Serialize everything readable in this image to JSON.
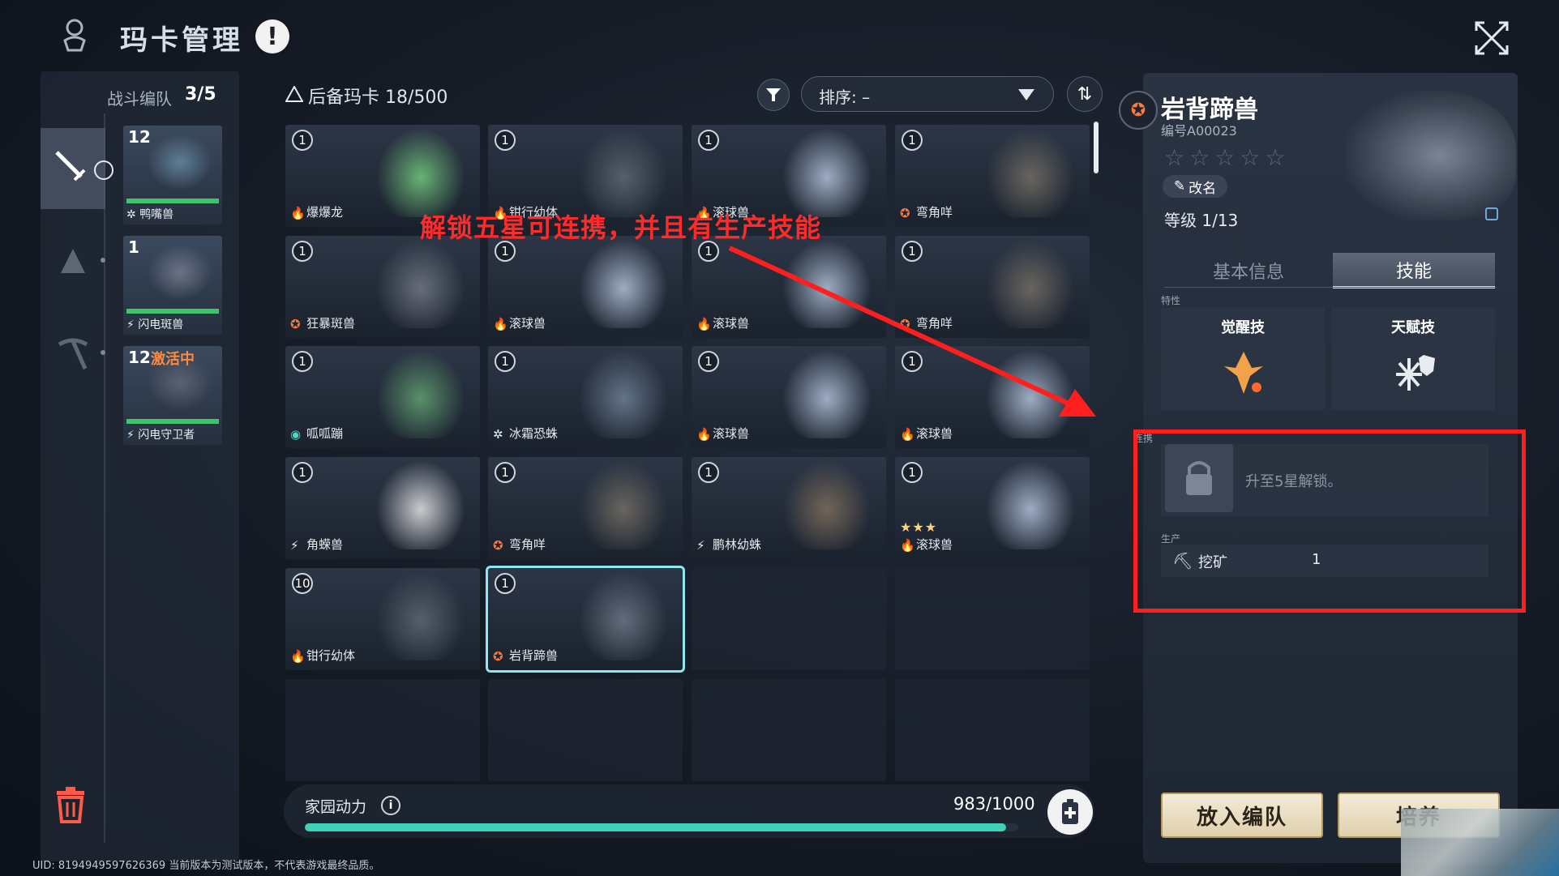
{
  "header": {
    "title": "玛卡管理",
    "alert_glyph": "!",
    "logo_icon": "emblem-icon",
    "close_icon": "collapse-icon"
  },
  "team": {
    "label": "战斗编队",
    "count": "3/5",
    "cards": [
      {
        "level": "12",
        "name": "鸭嘴兽",
        "element_glyph": "✲",
        "element_color": "#ffffff",
        "hp": 1.0,
        "color": "#5f7f95"
      },
      {
        "level": "1",
        "name": "闪电斑兽",
        "element_glyph": "⚡",
        "element_color": "#ffffff",
        "hp": 1.0,
        "color": "#6a7486"
      },
      {
        "level": "12",
        "name": "闪电守卫者",
        "element_glyph": "⚡",
        "element_color": "#ffffff",
        "hp": 1.0,
        "color": "#5a6272",
        "tag": "激活中"
      }
    ]
  },
  "reserve": {
    "label": "后备玛卡 18/500",
    "sort_label": "排序: –",
    "order_glyph": "⇅",
    "cards": [
      {
        "num": "1",
        "name": "爆爆龙",
        "element": "fire",
        "glyph": "🔥",
        "color": "#6fbf7a"
      },
      {
        "num": "1",
        "name": "钳行幼体",
        "element": "fire",
        "glyph": "🔥",
        "color": "#5a6470"
      },
      {
        "num": "1",
        "name": "滚球兽",
        "element": "fire",
        "glyph": "🔥",
        "color": "#a9b8d0"
      },
      {
        "num": "1",
        "name": "弯角咩",
        "element": "earth",
        "glyph": "✪",
        "color": "#6f6a62"
      },
      {
        "num": "1",
        "name": "狂暴斑兽",
        "element": "earth",
        "glyph": "✪",
        "color": "#6d7480"
      },
      {
        "num": "1",
        "name": "滚球兽",
        "element": "fire",
        "glyph": "🔥",
        "color": "#a9b8d0"
      },
      {
        "num": "1",
        "name": "滚球兽",
        "element": "fire",
        "glyph": "🔥",
        "color": "#a9b8d0"
      },
      {
        "num": "1",
        "name": "弯角咩",
        "element": "earth",
        "glyph": "✪",
        "color": "#6f6a62"
      },
      {
        "num": "1",
        "name": "呱呱蹦",
        "element": "water",
        "glyph": "◉",
        "color": "#5e9a6e"
      },
      {
        "num": "1",
        "name": "冰霜恐蛛",
        "element": "ice",
        "glyph": "✲",
        "color": "#6a7a90"
      },
      {
        "num": "1",
        "name": "滚球兽",
        "element": "fire",
        "glyph": "🔥",
        "color": "#a9b8d0"
      },
      {
        "num": "1",
        "name": "滚球兽",
        "element": "fire",
        "glyph": "🔥",
        "color": "#a9b8d0"
      },
      {
        "num": "1",
        "name": "角蝾兽",
        "element": "electric",
        "glyph": "⚡",
        "color": "#d9d9dc"
      },
      {
        "num": "1",
        "name": "弯角咩",
        "element": "earth",
        "glyph": "✪",
        "color": "#6f6a62"
      },
      {
        "num": "1",
        "name": "鹏林幼蛛",
        "element": "electric",
        "glyph": "⚡",
        "color": "#7a6a5a"
      },
      {
        "num": "1",
        "name": "滚球兽",
        "element": "fire",
        "glyph": "🔥",
        "color": "#a9b8d0",
        "stars": "★★★"
      },
      {
        "num": "10",
        "name": "钳行幼体",
        "element": "fire",
        "glyph": "🔥",
        "color": "#5a6470"
      },
      {
        "num": "1",
        "name": "岩背蹄兽",
        "element": "earth",
        "glyph": "✪",
        "color": "#6a7282",
        "selected": true
      }
    ],
    "empty_slots": 6
  },
  "annotation": "解锁五星可连携，并且有生产技能",
  "energy": {
    "label": "家园动力",
    "info_glyph": "i",
    "value": "983/1000",
    "fraction": 0.983
  },
  "footer": "UID: 8194949597626369 当前版本为测试版本，不代表游戏最终品质。",
  "detail": {
    "name": "岩背蹄兽",
    "id": "编号A00023",
    "stars": "☆☆☆☆☆",
    "rename_label": "改名",
    "level": "等级 1/13",
    "element_glyph": "✪",
    "tabs": {
      "basic": "基本信息",
      "skills": "技能"
    },
    "trait_tag": "特性",
    "awaken_label": "觉醒技",
    "talent_label": "天赋技",
    "combo_tag": "连携",
    "lock_text": "升至5星解锁。",
    "prod_tag": "生产",
    "prod_name": "挖矿",
    "prod_value": "1"
  },
  "buttons": {
    "add_team": "放入编队",
    "cultivate": "培养"
  },
  "colors": {
    "accent": "#3fd0b6",
    "annotation_red": "#ff1f1f",
    "fire": "#ff7a3a"
  }
}
